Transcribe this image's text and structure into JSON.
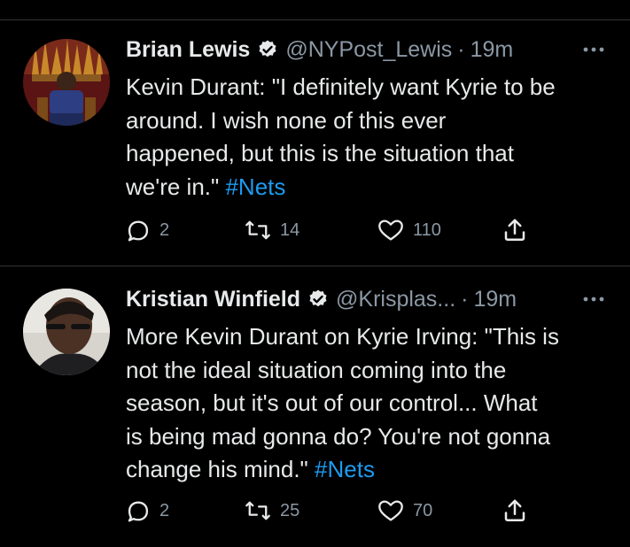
{
  "tweets": [
    {
      "author": "Brian Lewis",
      "handle": "@NYPost_Lewis",
      "separator": "·",
      "time": "19m",
      "text_lines": [
        "Kevin Durant: \"I definitely want Kyrie to be",
        "around. I wish none of this ever",
        "happened, but this is the situation that",
        "we're in.\""
      ],
      "hashtag": "#Nets",
      "replies": "2",
      "retweets": "14",
      "likes": "110"
    },
    {
      "author": "Kristian Winfield",
      "handle": "@Krisplas...",
      "separator": "·",
      "time": "19m",
      "text_lines": [
        "More Kevin Durant on Kyrie Irving: \"This is",
        "not the ideal situation coming into the",
        "season, but it's out of our control... What",
        "is being mad gonna do? You're not gonna",
        "change his mind.\""
      ],
      "hashtag": "#Nets",
      "replies": "2",
      "retweets": "25",
      "likes": "70"
    }
  ],
  "colors": {
    "background": "#000000",
    "text": "#e7e9ea",
    "muted": "#8b98a5",
    "accent": "#1d9bf0",
    "divider": "#2f3336"
  },
  "icons": [
    "verified-badge-icon",
    "more-options-icon",
    "reply-icon",
    "retweet-icon",
    "like-icon",
    "share-icon"
  ]
}
